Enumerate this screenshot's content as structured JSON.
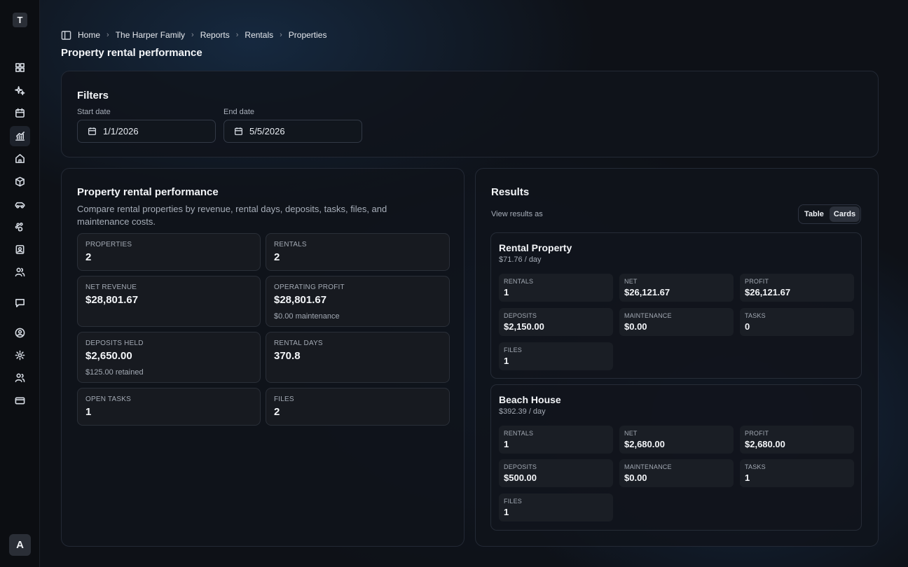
{
  "rail": {
    "logo": "T",
    "avatar": "A",
    "icons": [
      "dashboard-icon",
      "sparkles-icon",
      "calendar-icon",
      "chart-icon",
      "home-icon",
      "box-icon",
      "car-icon",
      "pets-icon",
      "contacts-icon",
      "users-icon",
      "chat-icon",
      "account-icon",
      "settings-icon",
      "team-icon",
      "billing-icon"
    ]
  },
  "breadcrumb": [
    "Home",
    "The Harper Family",
    "Reports",
    "Rentals",
    "Properties"
  ],
  "page_title": "Property rental performance",
  "filters": {
    "title": "Filters",
    "start_label": "Start date",
    "start_value": "1/1/2026",
    "end_label": "End date",
    "end_value": "5/5/2026"
  },
  "summary": {
    "title": "Property rental performance",
    "description": "Compare rental properties by revenue, rental days, deposits, tasks, files, and maintenance costs.",
    "stats": [
      {
        "label": "PROPERTIES",
        "value": "2"
      },
      {
        "label": "RENTALS",
        "value": "2"
      },
      {
        "label": "NET REVENUE",
        "value": "$28,801.67"
      },
      {
        "label": "OPERATING PROFIT",
        "value": "$28,801.67",
        "sub": "$0.00 maintenance"
      },
      {
        "label": "DEPOSITS HELD",
        "value": "$2,650.00",
        "sub": "$125.00 retained"
      },
      {
        "label": "RENTAL DAYS",
        "value": "370.8"
      },
      {
        "label": "OPEN TASKS",
        "value": "1"
      },
      {
        "label": "FILES",
        "value": "2"
      }
    ]
  },
  "results": {
    "title": "Results",
    "view_label": "View results as",
    "view_options": [
      "Table",
      "Cards"
    ],
    "selected_view": "Cards",
    "cards": [
      {
        "name": "Rental Property",
        "rate": "$71.76 / day",
        "metrics": [
          {
            "label": "RENTALS",
            "value": "1"
          },
          {
            "label": "NET",
            "value": "$26,121.67"
          },
          {
            "label": "PROFIT",
            "value": "$26,121.67"
          },
          {
            "label": "DEPOSITS",
            "value": "$2,150.00"
          },
          {
            "label": "MAINTENANCE",
            "value": "$0.00"
          },
          {
            "label": "TASKS",
            "value": "0"
          },
          {
            "label": "FILES",
            "value": "1"
          }
        ]
      },
      {
        "name": "Beach House",
        "rate": "$392.39 / day",
        "metrics": [
          {
            "label": "RENTALS",
            "value": "1"
          },
          {
            "label": "NET",
            "value": "$2,680.00"
          },
          {
            "label": "PROFIT",
            "value": "$2,680.00"
          },
          {
            "label": "DEPOSITS",
            "value": "$500.00"
          },
          {
            "label": "MAINTENANCE",
            "value": "$0.00"
          },
          {
            "label": "TASKS",
            "value": "1"
          },
          {
            "label": "FILES",
            "value": "1"
          }
        ]
      }
    ]
  }
}
